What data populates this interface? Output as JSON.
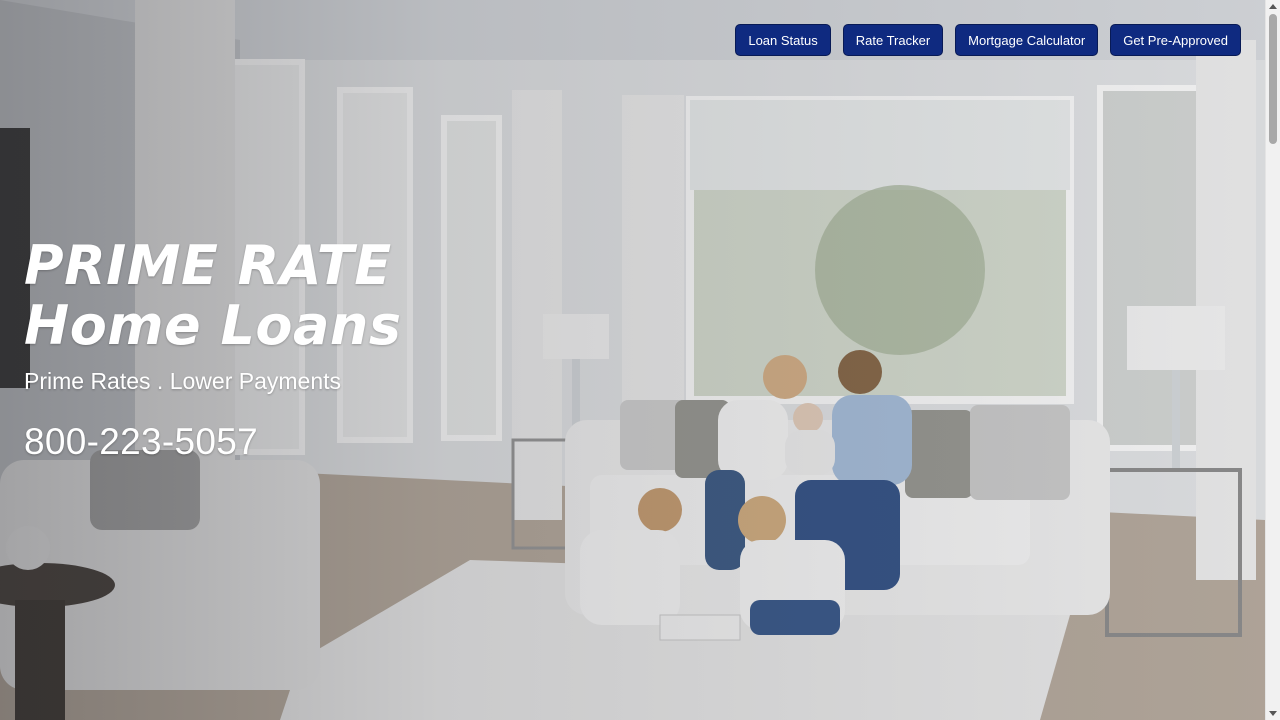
{
  "nav": {
    "items": [
      {
        "label": "Loan Status"
      },
      {
        "label": "Rate Tracker"
      },
      {
        "label": "Mortgage Calculator"
      },
      {
        "label": "Get Pre-Approved"
      }
    ],
    "button_color": "#0f2a80"
  },
  "hero": {
    "brand_line_1": "PRIME RATE",
    "brand_line_2": "Home Loans",
    "tagline": "Prime Rates . Lower Payments",
    "phone": "800-223-5057",
    "background_image": "living-room-family-photo"
  }
}
